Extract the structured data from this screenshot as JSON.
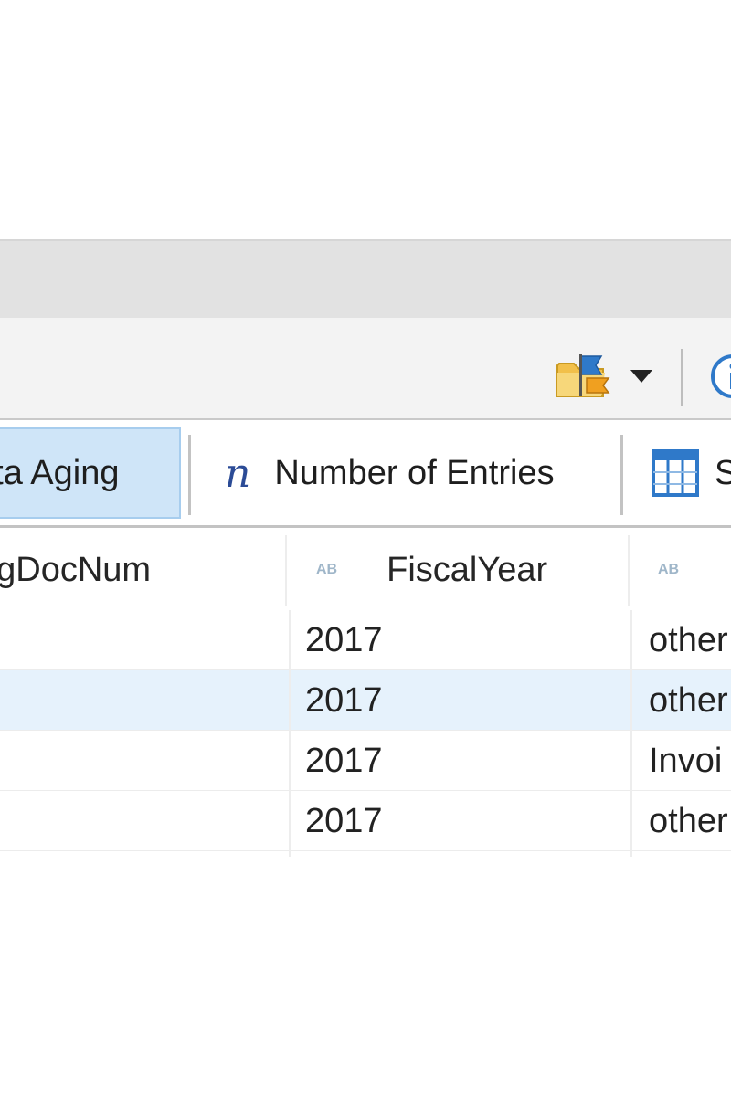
{
  "toolbar": {
    "folder_icon": "folder-flag-icon",
    "dropdown_icon": "caret-down-icon",
    "info_icon": "info-icon"
  },
  "tabs": [
    {
      "label": "ata Aging",
      "active": true
    },
    {
      "label": "Number of Entries",
      "icon": "n",
      "active": false
    },
    {
      "label": "S",
      "icon": "grid-icon",
      "active": false
    }
  ],
  "table": {
    "columns": [
      {
        "label": "tingDocNum"
      },
      {
        "label": "FiscalYear",
        "type_icon": "AB"
      },
      {
        "label": "",
        "type_icon": "AB"
      }
    ],
    "rows": [
      {
        "fiscal_year": "2017",
        "col3": "other",
        "selected": false
      },
      {
        "fiscal_year": "2017",
        "col3": "other",
        "selected": true
      },
      {
        "fiscal_year": "2017",
        "col3": "Invoi",
        "selected": false
      },
      {
        "fiscal_year": "2017",
        "col3": "other",
        "selected": false
      }
    ]
  },
  "colors": {
    "active_tab_bg": "#cfe5f8",
    "selected_row_bg": "#e6f2fc",
    "n_icon": "#2b4b96"
  }
}
